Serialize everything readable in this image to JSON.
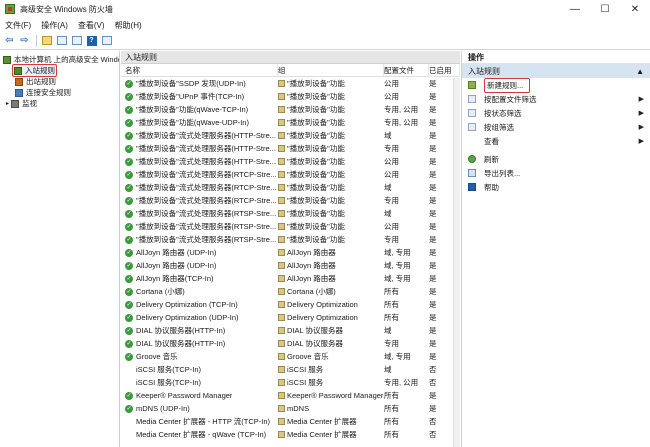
{
  "window": {
    "title": "高级安全 Windows 防火墙",
    "controls": [
      "—",
      "☐",
      "✕"
    ]
  },
  "menu": [
    "文件(F)",
    "操作(A)",
    "查看(V)",
    "帮助(H)"
  ],
  "tree": {
    "root": "本地计算机 上的高级安全 Windows",
    "items": [
      "入站规则",
      "出站规则",
      "连接安全规则",
      "监视"
    ]
  },
  "center": {
    "header": "入站规则",
    "columns": {
      "name": "名称",
      "group": "组",
      "profile": "配置文件",
      "enabled": "已启用"
    },
    "rows": [
      {
        "name": "\"播放到设备\"SSDP 发现(UDP-In)",
        "group": "\"播放到设备\"功能",
        "profile": "公用",
        "enabled": "是",
        "status": "on"
      },
      {
        "name": "\"播放到设备\"UPnP 事件(TCP-In)",
        "group": "\"播放到设备\"功能",
        "profile": "公用",
        "enabled": "是",
        "status": "on"
      },
      {
        "name": "\"播放到设备\"功能(qWave-TCP-In)",
        "group": "\"播放到设备\"功能",
        "profile": "专用, 公用",
        "enabled": "是",
        "status": "on"
      },
      {
        "name": "\"播放到设备\"功能(qWave-UDP-In)",
        "group": "\"播放到设备\"功能",
        "profile": "专用, 公用",
        "enabled": "是",
        "status": "on"
      },
      {
        "name": "\"播放到设备\"流式处理服务器(HTTP-Stre...",
        "group": "\"播放到设备\"功能",
        "profile": "域",
        "enabled": "是",
        "status": "on"
      },
      {
        "name": "\"播放到设备\"流式处理服务器(HTTP-Stre...",
        "group": "\"播放到设备\"功能",
        "profile": "专用",
        "enabled": "是",
        "status": "on"
      },
      {
        "name": "\"播放到设备\"流式处理服务器(HTTP-Stre...",
        "group": "\"播放到设备\"功能",
        "profile": "公用",
        "enabled": "是",
        "status": "on"
      },
      {
        "name": "\"播放到设备\"流式处理服务器(RTCP-Stre...",
        "group": "\"播放到设备\"功能",
        "profile": "公用",
        "enabled": "是",
        "status": "on"
      },
      {
        "name": "\"播放到设备\"流式处理服务器(RTCP-Stre...",
        "group": "\"播放到设备\"功能",
        "profile": "域",
        "enabled": "是",
        "status": "on"
      },
      {
        "name": "\"播放到设备\"流式处理服务器(RTCP-Stre...",
        "group": "\"播放到设备\"功能",
        "profile": "专用",
        "enabled": "是",
        "status": "on"
      },
      {
        "name": "\"播放到设备\"流式处理服务器(RTSP-Stre...",
        "group": "\"播放到设备\"功能",
        "profile": "域",
        "enabled": "是",
        "status": "on"
      },
      {
        "name": "\"播放到设备\"流式处理服务器(RTSP-Stre...",
        "group": "\"播放到设备\"功能",
        "profile": "公用",
        "enabled": "是",
        "status": "on"
      },
      {
        "name": "\"播放到设备\"流式处理服务器(RTSP-Stre...",
        "group": "\"播放到设备\"功能",
        "profile": "专用",
        "enabled": "是",
        "status": "on"
      },
      {
        "name": "AllJoyn 路由器 (UDP-In)",
        "group": "AllJoyn 路由器",
        "profile": "域, 专用",
        "enabled": "是",
        "status": "on"
      },
      {
        "name": "AllJoyn 路由器 (UDP-In)",
        "group": "AllJoyn 路由器",
        "profile": "域, 专用",
        "enabled": "是",
        "status": "on"
      },
      {
        "name": "AllJoyn 路由器(TCP-In)",
        "group": "AllJoyn 路由器",
        "profile": "域, 专用",
        "enabled": "是",
        "status": "on"
      },
      {
        "name": "Cortana (小娜)",
        "group": "Cortana (小娜)",
        "profile": "所有",
        "enabled": "是",
        "status": "on"
      },
      {
        "name": "Delivery Optimization (TCP-In)",
        "group": "Delivery Optimization",
        "profile": "所有",
        "enabled": "是",
        "status": "on"
      },
      {
        "name": "Delivery Optimization (UDP-In)",
        "group": "Delivery Optimization",
        "profile": "所有",
        "enabled": "是",
        "status": "on"
      },
      {
        "name": "DIAL 协议服务器(HTTP-In)",
        "group": "DIAL 协议服务器",
        "profile": "域",
        "enabled": "是",
        "status": "on"
      },
      {
        "name": "DIAL 协议服务器(HTTP-In)",
        "group": "DIAL 协议服务器",
        "profile": "专用",
        "enabled": "是",
        "status": "on"
      },
      {
        "name": "Groove 音乐",
        "group": "Groove 音乐",
        "profile": "域, 专用",
        "enabled": "是",
        "status": "on"
      },
      {
        "name": "iSCSI 服务(TCP-In)",
        "group": "iSCSI 服务",
        "profile": "域",
        "enabled": "否",
        "status": "off"
      },
      {
        "name": "iSCSI 服务(TCP-In)",
        "group": "iSCSI 服务",
        "profile": "专用, 公用",
        "enabled": "否",
        "status": "off"
      },
      {
        "name": "Keeper® Password Manager",
        "group": "Keeper® Password Manager",
        "profile": "所有",
        "enabled": "是",
        "status": "on"
      },
      {
        "name": "mDNS (UDP-In)",
        "group": "mDNS",
        "profile": "所有",
        "enabled": "是",
        "status": "on"
      },
      {
        "name": "Media Center 扩展器 - HTTP 流(TCP-In)",
        "group": "Media Center 扩展器",
        "profile": "所有",
        "enabled": "否",
        "status": "off"
      },
      {
        "name": "Media Center 扩展器 - qWave (TCP-In)",
        "group": "Media Center 扩展器",
        "profile": "所有",
        "enabled": "否",
        "status": "off"
      }
    ]
  },
  "actions": {
    "title": "操作",
    "section": "入站规则",
    "items": [
      {
        "label": "新建规则...",
        "icon": "new-rule-icon",
        "arrow": false
      },
      {
        "label": "按配置文件筛选",
        "icon": "filter-icon",
        "arrow": true
      },
      {
        "label": "按状态筛选",
        "icon": "filter-icon",
        "arrow": true
      },
      {
        "label": "按组筛选",
        "icon": "filter-icon",
        "arrow": true
      },
      {
        "label": "查看",
        "icon": "",
        "arrow": true
      },
      {
        "label": "刷新",
        "icon": "refresh-icon",
        "arrow": false
      },
      {
        "label": "导出列表...",
        "icon": "export-icon",
        "arrow": false
      },
      {
        "label": "帮助",
        "icon": "help-icon",
        "arrow": false
      }
    ]
  },
  "colors": {
    "enabled_check": "#3c9a3c",
    "selection_highlight": "#d9383a",
    "section_bg": "#d6e4f2"
  }
}
